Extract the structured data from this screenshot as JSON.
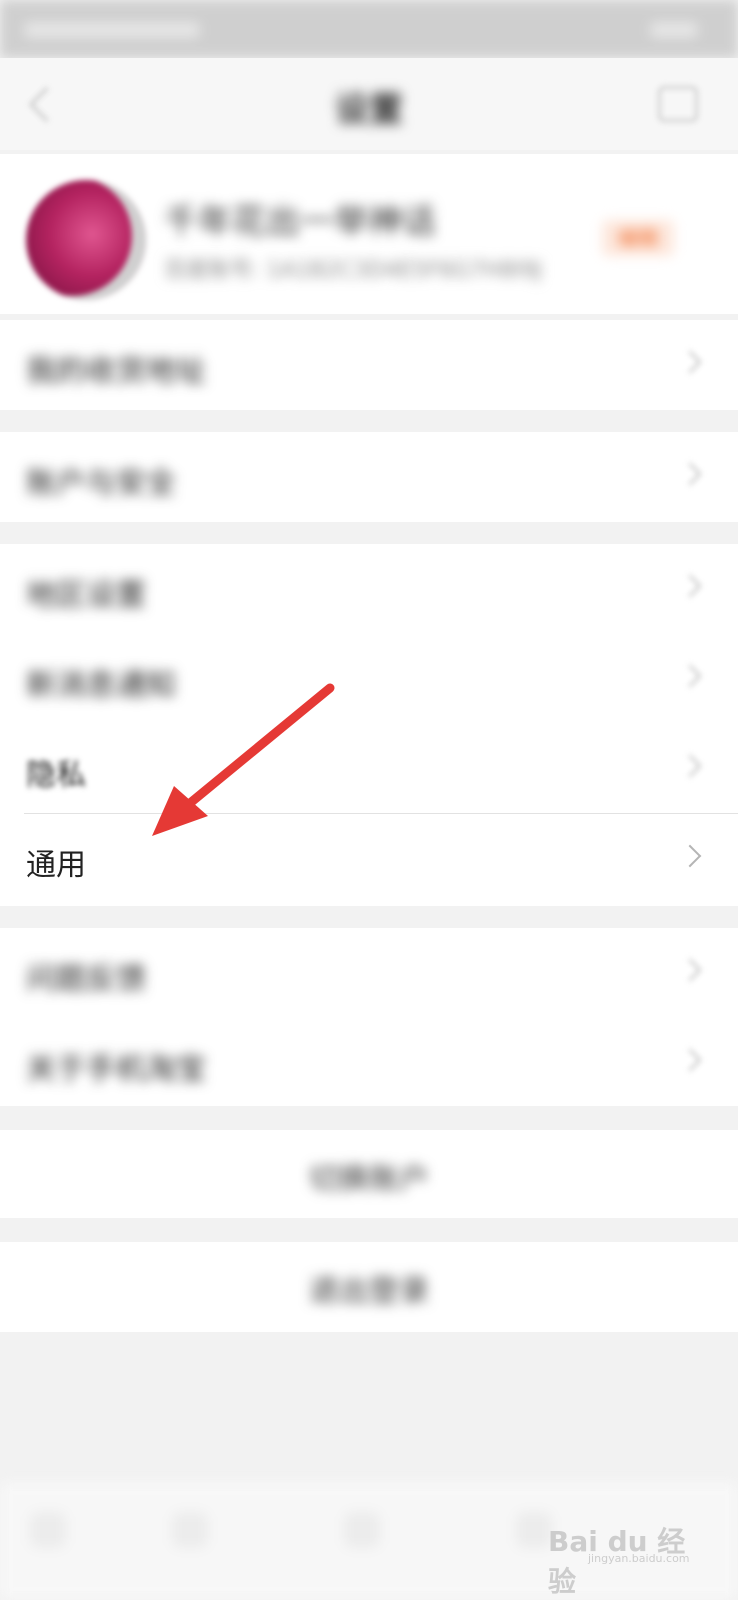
{
  "header": {
    "title": "设置"
  },
  "profile": {
    "name": "千年花出一举神话",
    "subtitle": "百度账号: 1A1B2C3D4E5F6G7H8I9J",
    "badge": "编辑"
  },
  "menu": {
    "group1": [
      {
        "label": "我的收货地址"
      }
    ],
    "group2": [
      {
        "label": "账户与安全"
      }
    ],
    "group3": [
      {
        "label": "地区设置"
      },
      {
        "label": "新消息通知"
      },
      {
        "label": "隐私"
      },
      {
        "label": "通用"
      }
    ],
    "group4": [
      {
        "label": "问题反馈"
      },
      {
        "label": "关于手机淘宝"
      }
    ]
  },
  "actions": {
    "switch_account": "切换账户",
    "logout": "退出登录"
  },
  "annotation": {
    "arrow_color": "#e53935"
  },
  "watermark": {
    "text": "Bai du 经验",
    "sub": "jingyan.baidu.com"
  },
  "icons": [
    "back-arrow-icon",
    "menu-icon",
    "chevron-right-icon"
  ]
}
